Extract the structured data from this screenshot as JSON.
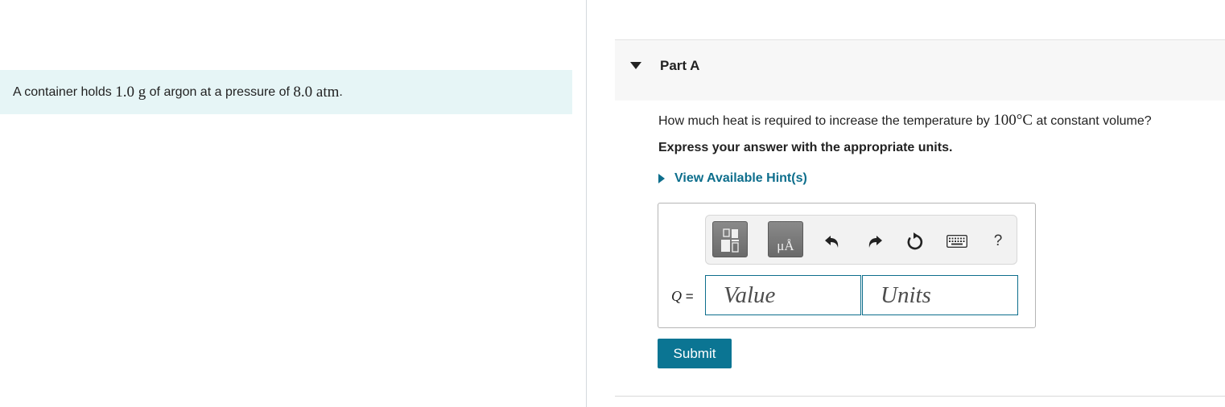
{
  "problem": {
    "text_before_mass": "A container holds ",
    "mass": "1.0 g",
    "text_middle": " of argon at a pressure of ",
    "pressure": "8.0 atm",
    "text_end": "."
  },
  "part": {
    "title": "Part A",
    "question_before": "How much heat is required to increase the temperature by ",
    "question_value": "100°C",
    "question_after": " at constant volume?",
    "instructions": "Express your answer with the appropriate units.",
    "hints_label": "View Available Hint(s)"
  },
  "toolbar": {
    "units_button_label": "μÅ",
    "help_label": "?"
  },
  "answer": {
    "variable": "Q",
    "equals": " =",
    "value_placeholder": "Value",
    "units_placeholder": "Units"
  },
  "submit_label": "Submit",
  "colors": {
    "accent": "#0b7593",
    "banner_bg": "#e6f5f6"
  }
}
